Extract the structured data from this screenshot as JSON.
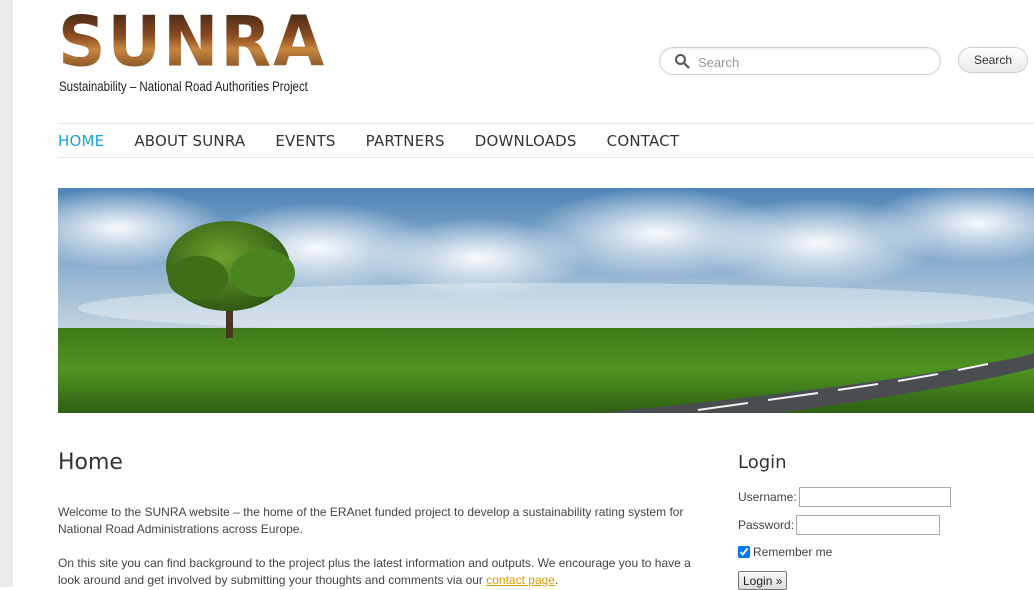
{
  "brand": {
    "name": "SUNRA",
    "tagline": "Sustainability – National Road Authorities Project"
  },
  "search": {
    "placeholder": "Search",
    "button_label": "Search"
  },
  "nav": {
    "items": [
      {
        "label": "HOME",
        "active": true
      },
      {
        "label": "ABOUT SUNRA",
        "active": false
      },
      {
        "label": "EVENTS",
        "active": false
      },
      {
        "label": "PARTNERS",
        "active": false
      },
      {
        "label": "DOWNLOADS",
        "active": false
      },
      {
        "label": "CONTACT",
        "active": false
      }
    ]
  },
  "main": {
    "title": "Home",
    "paragraph1": "Welcome to the SUNRA website – the home of the ERAnet funded project to develop a sustainability rating system for National Road Administrations across Europe.",
    "paragraph2_prefix": "On this site you can find background to the project plus the latest information and outputs. We encourage you to have a look around and get involved by submitting your thoughts and comments via our ",
    "paragraph2_link": "contact page",
    "paragraph2_suffix": "."
  },
  "login": {
    "title": "Login",
    "username_label": "Username:",
    "password_label": "Password:",
    "remember_label": "Remember me",
    "remember_checked": true,
    "button_label": "Login »"
  },
  "colors": {
    "accent": "#1aa3d6",
    "link": "#d99a00",
    "logo_brown": "#7a4320"
  }
}
